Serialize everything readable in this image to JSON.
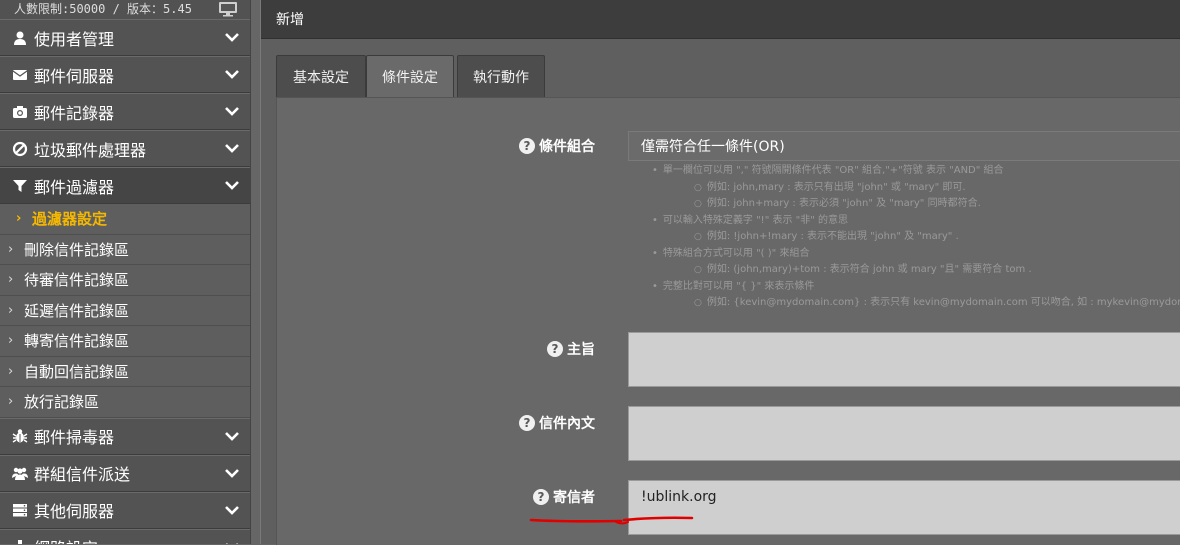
{
  "sidebar": {
    "header_text": "人數限制:50000 / 版本：5.45",
    "items": [
      {
        "label": "使用者管理",
        "icon": "user-icon"
      },
      {
        "label": "郵件伺服器",
        "icon": "envelope-icon"
      },
      {
        "label": "郵件記錄器",
        "icon": "camera-icon"
      },
      {
        "label": "垃圾郵件處理器",
        "icon": "ban-icon"
      },
      {
        "label": "郵件過濾器",
        "icon": "filter-icon"
      }
    ],
    "sub_items": [
      {
        "label": "過濾器設定"
      },
      {
        "label": "刪除信件記錄區"
      },
      {
        "label": "待審信件記錄區"
      },
      {
        "label": "延遲信件記錄區"
      },
      {
        "label": "轉寄信件記錄區"
      },
      {
        "label": "自動回信記錄區"
      },
      {
        "label": "放行記錄區"
      }
    ],
    "items_after": [
      {
        "label": "郵件掃毒器",
        "icon": "bug-icon"
      },
      {
        "label": "群組信件派送",
        "icon": "users-icon"
      },
      {
        "label": "其他伺服器",
        "icon": "server-icon"
      },
      {
        "label": "網路設定",
        "icon": "sitemap-icon"
      }
    ]
  },
  "panel": {
    "title": "新增",
    "tabs": [
      {
        "label": "基本設定"
      },
      {
        "label": "條件設定"
      },
      {
        "label": "執行動作"
      }
    ],
    "active_tab": "條件設定"
  },
  "form": {
    "condition_label": "條件組合",
    "condition_value": "僅需符合任一條件(OR)",
    "hints": [
      {
        "level": 1,
        "text": "單一欄位可以用 \",\" 符號隔開條件代表 \"OR\" 組合,\"+\"符號 表示 \"AND\" 組合"
      },
      {
        "level": 2,
        "text": "例如: john,mary : 表示只有出現 \"john\" 或 \"mary\" 即可."
      },
      {
        "level": 2,
        "text": "例如: john+mary : 表示必須 \"john\" 及 \"mary\" 同時都符合."
      },
      {
        "level": 1,
        "text": "可以輸入特殊定義字 \"!\" 表示 \"非\" 的意思"
      },
      {
        "level": 2,
        "text": "例如: !john+!mary : 表示不能出現 \"john\" 及 \"mary\" ."
      },
      {
        "level": 1,
        "text": "特殊組合方式可以用 \"( )\" 來組合"
      },
      {
        "level": 2,
        "text": "例如: (john,mary)+tom : 表示符合 john 或 mary \"且\" 需要符合 tom ."
      },
      {
        "level": 1,
        "text": "完整比對可以用 \"{ }\" 來表示條件"
      },
      {
        "level": 2,
        "text": "例如: {kevin@mydomain.com} : 表示只有 kevin@mydomain.com 可以吻合, 如 : mykevin@mydomain"
      }
    ],
    "subject_label": "主旨",
    "subject_value": "",
    "body_label": "信件內文",
    "body_value": "",
    "sender_label": "寄信者",
    "sender_value": "!ublink.org"
  },
  "colors": {
    "accent": "#f5b800",
    "annotation": "#e00000"
  }
}
